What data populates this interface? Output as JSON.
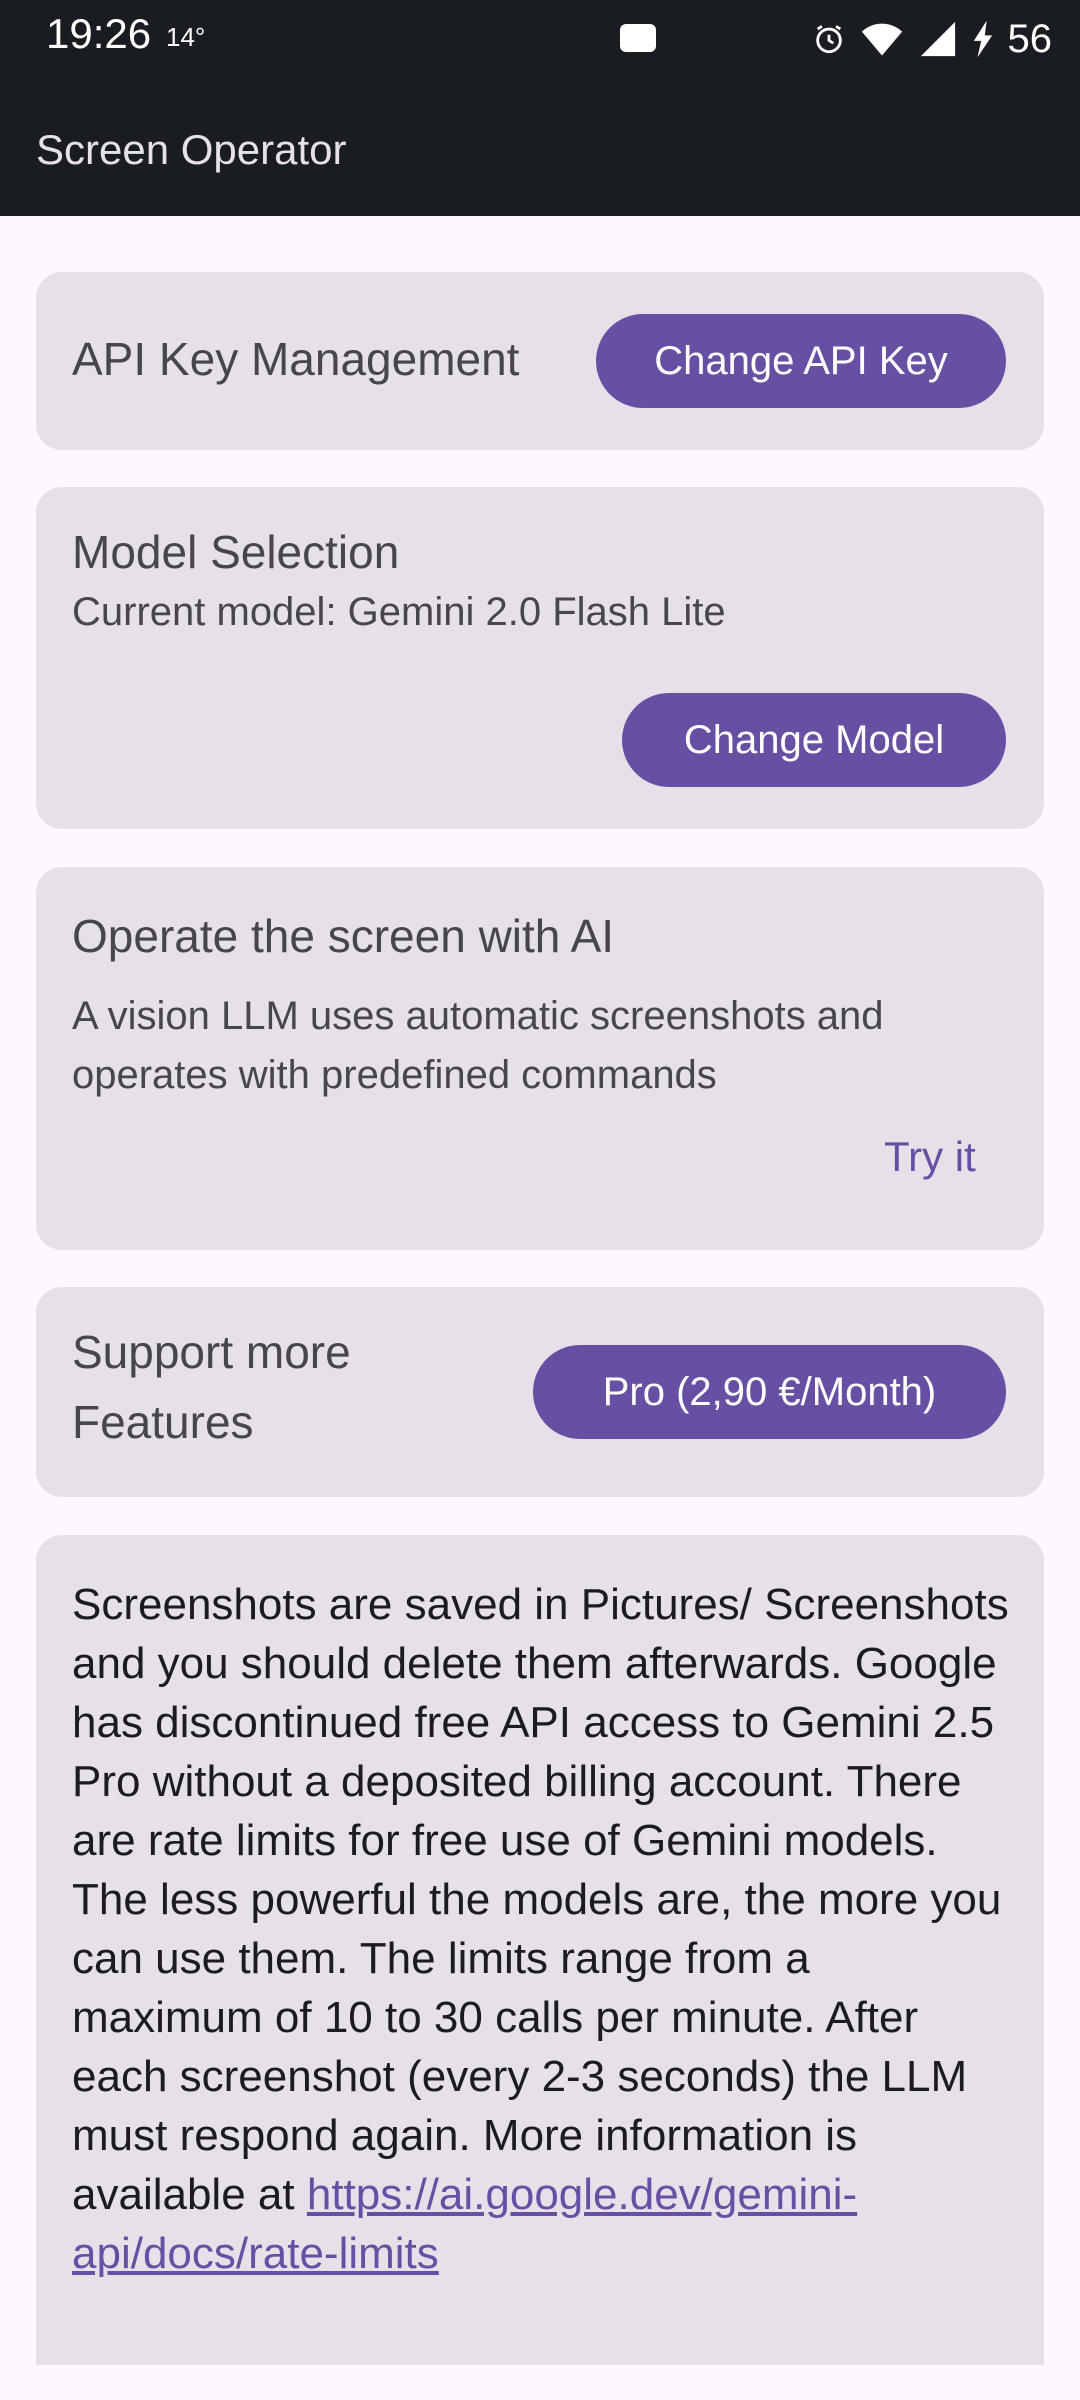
{
  "status_bar": {
    "time": "19:26",
    "temperature": "14°",
    "battery": "56",
    "icons": [
      "notification-icon",
      "alarm-icon",
      "wifi-icon",
      "signal-icon",
      "charging-icon"
    ]
  },
  "app_bar": {
    "title": "Screen Operator"
  },
  "api_card": {
    "title": "API Key Management",
    "button_label": "Change API Key"
  },
  "model_card": {
    "title": "Model Selection",
    "current_model": "Current model: Gemini 2.0 Flash Lite",
    "button_label": "Change Model"
  },
  "operate_card": {
    "title": "Operate the screen with AI",
    "description": "A vision LLM uses automatic screenshots and operates with predefined commands",
    "action_label": "Try it"
  },
  "support_card": {
    "title_line1": "Support more",
    "title_line2": "Features",
    "button_label": "Pro (2,90 €/Month)"
  },
  "info_card": {
    "text": "Screenshots are saved in Pictures/ Screenshots and you should delete them afterwards. Google has discontinued free API access to Gemini 2.5 Pro without a deposited billing account. There are rate limits for free use of Gemini models. The less powerful the models are, the more you can use them. The limits range from a maximum of 10 to 30 calls per minute. After each screenshot (every 2-3 seconds) the LLM must respond again. More information is available at",
    "link": "https://ai.google.dev/gemini-api/docs/rate-limits"
  },
  "colors": {
    "primary": "#6750a4",
    "card_background": "#e6e0e9",
    "app_bar": "#191c20",
    "page_background": "#fef7ff"
  }
}
